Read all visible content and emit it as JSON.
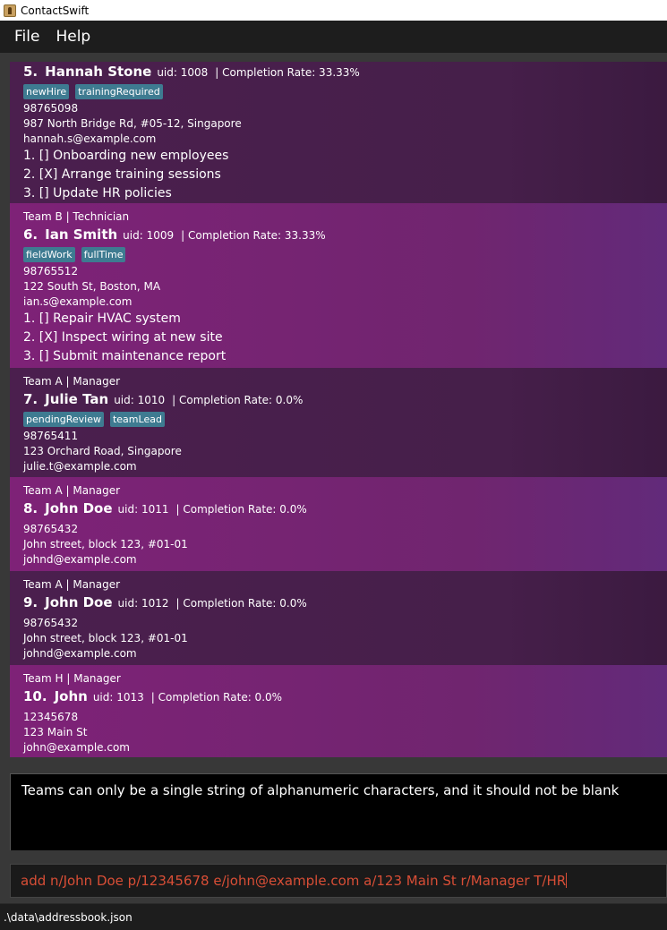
{
  "window": {
    "title": "ContactSwift"
  },
  "menu": {
    "file": "File",
    "help": "Help"
  },
  "persons": [
    {
      "team_role": "",
      "index": "5.",
      "name": "Hannah Stone",
      "uid": "uid: 1008",
      "rate": "| Completion Rate: 33.33%",
      "tags": [
        "newHire",
        "trainingRequired"
      ],
      "phone": "98765098",
      "address": "987 North Bridge Rd, #05-12, Singapore",
      "email": "hannah.s@example.com",
      "tasks": [
        "1. [] Onboarding new employees",
        "2. [X] Arrange training sessions",
        "3. [] Update HR policies"
      ]
    },
    {
      "team_role": "Team B | Technician",
      "index": "6.",
      "name": "Ian Smith",
      "uid": "uid: 1009",
      "rate": "| Completion Rate: 33.33%",
      "tags": [
        "fieldWork",
        "fullTime"
      ],
      "phone": "98765512",
      "address": "122 South St, Boston, MA",
      "email": "ian.s@example.com",
      "tasks": [
        "1. [] Repair HVAC system",
        "2. [X] Inspect wiring at new site",
        "3. [] Submit maintenance report"
      ]
    },
    {
      "team_role": "Team A | Manager",
      "index": "7.",
      "name": "Julie Tan",
      "uid": "uid: 1010",
      "rate": "| Completion Rate: 0.0%",
      "tags": [
        "pendingReview",
        "teamLead"
      ],
      "phone": "98765411",
      "address": "123 Orchard Road, Singapore",
      "email": "julie.t@example.com",
      "tasks": []
    },
    {
      "team_role": "Team A | Manager",
      "index": "8.",
      "name": "John Doe",
      "uid": "uid: 1011",
      "rate": "| Completion Rate: 0.0%",
      "tags": [],
      "phone": "98765432",
      "address": "John street, block 123, #01-01",
      "email": "johnd@example.com",
      "tasks": []
    },
    {
      "team_role": "Team A | Manager",
      "index": "9.",
      "name": "John Doe",
      "uid": "uid: 1012",
      "rate": "| Completion Rate: 0.0%",
      "tags": [],
      "phone": "98765432",
      "address": "John street, block 123, #01-01",
      "email": "johnd@example.com",
      "tasks": []
    },
    {
      "team_role": "Team H | Manager",
      "index": "10.",
      "name": "John",
      "uid": "uid: 1013",
      "rate": "| Completion Rate: 0.0%",
      "tags": [],
      "phone": "12345678",
      "address": "123 Main St",
      "email": "john@example.com",
      "tasks": []
    }
  ],
  "result": {
    "message": "Teams can only be a single string of alphanumeric characters, and it should not be blank"
  },
  "command": {
    "value": "add n/John Doe p/12345678 e/john@example.com a/123 Main St r/Manager T/HR"
  },
  "status": {
    "path": ".\\data\\addressbook.json"
  },
  "colors": {
    "card_dark": "#4b1f4e",
    "card_light": "#7e2277",
    "tag": "#3e7b91",
    "command_text": "#d84e36"
  }
}
